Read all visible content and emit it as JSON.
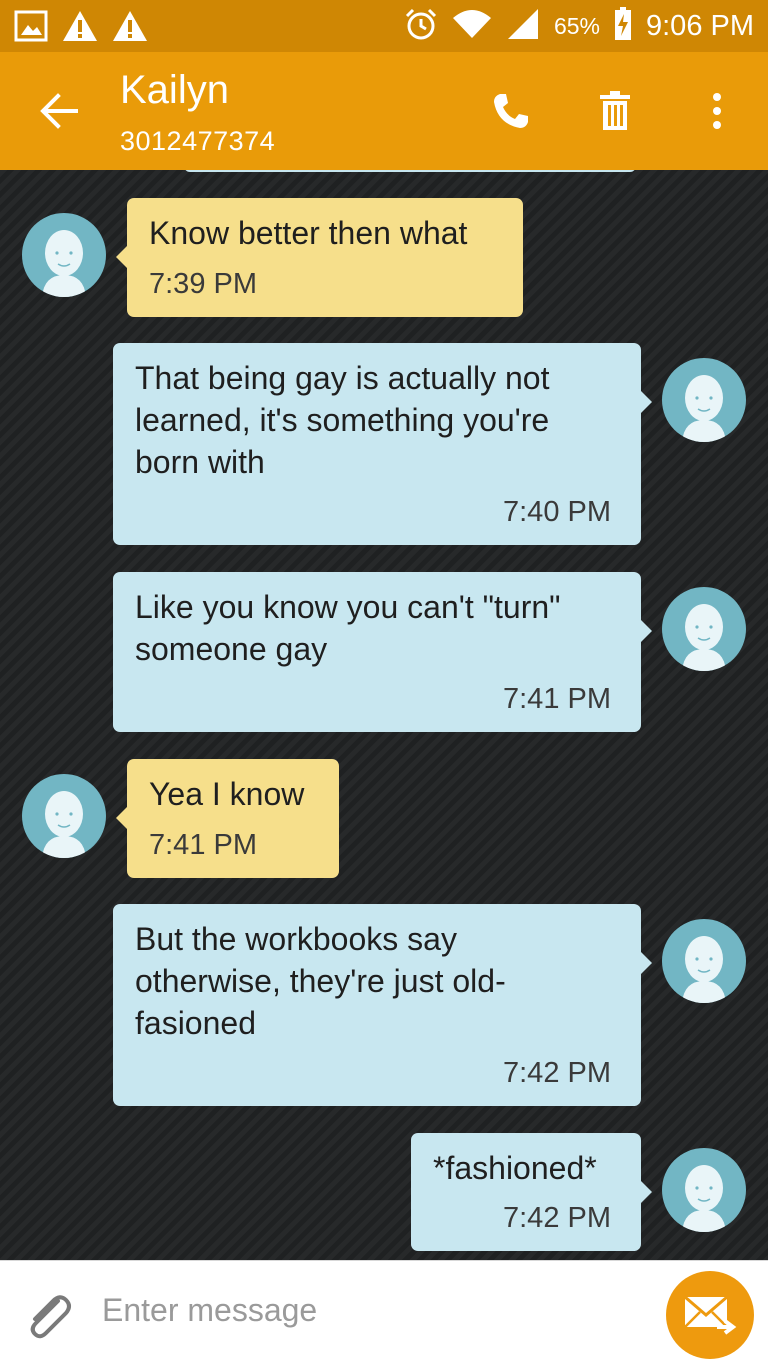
{
  "status_bar": {
    "battery": "65%",
    "time": "9:06 PM"
  },
  "header": {
    "contact_name": "Kailyn",
    "phone_number": "3012477374"
  },
  "messages": [
    {
      "direction": "in",
      "lines": [
        "Know better then what"
      ],
      "time": "7:39 PM"
    },
    {
      "direction": "out",
      "lines": [
        "That being gay is actually not",
        "learned, it's something you're",
        "born with"
      ],
      "time": "7:40 PM"
    },
    {
      "direction": "out",
      "lines": [
        "Like you know you can't \"turn\"",
        "someone gay"
      ],
      "time": "7:41 PM"
    },
    {
      "direction": "in",
      "lines": [
        "Yea I know"
      ],
      "time": "7:41 PM"
    },
    {
      "direction": "out",
      "lines": [
        "But the workbooks say",
        "otherwise, they're just old-",
        "fasioned"
      ],
      "time": "7:42 PM"
    },
    {
      "direction": "out",
      "lines": [
        "*fashioned*"
      ],
      "time": "7:42 PM"
    }
  ],
  "composer": {
    "placeholder": "Enter message"
  },
  "icons": {
    "status_left": [
      "image-icon",
      "warning-icon",
      "warning-icon"
    ],
    "status_right": [
      "alarm-icon",
      "wifi-icon",
      "signal-icon",
      "battery-charging-icon"
    ],
    "header": [
      "back-arrow-icon",
      "phone-icon",
      "trash-icon",
      "more-vert-icon"
    ],
    "composer": [
      "paperclip-icon",
      "send-envelope-icon"
    ]
  },
  "colors": {
    "status_bar": "#cf8704",
    "app_bar": "#e99b09",
    "incoming_bubble": "#f6df8b",
    "outgoing_bubble": "#c8e7f0",
    "avatar": "#72b6c4",
    "send_button": "#ee9a0e"
  }
}
